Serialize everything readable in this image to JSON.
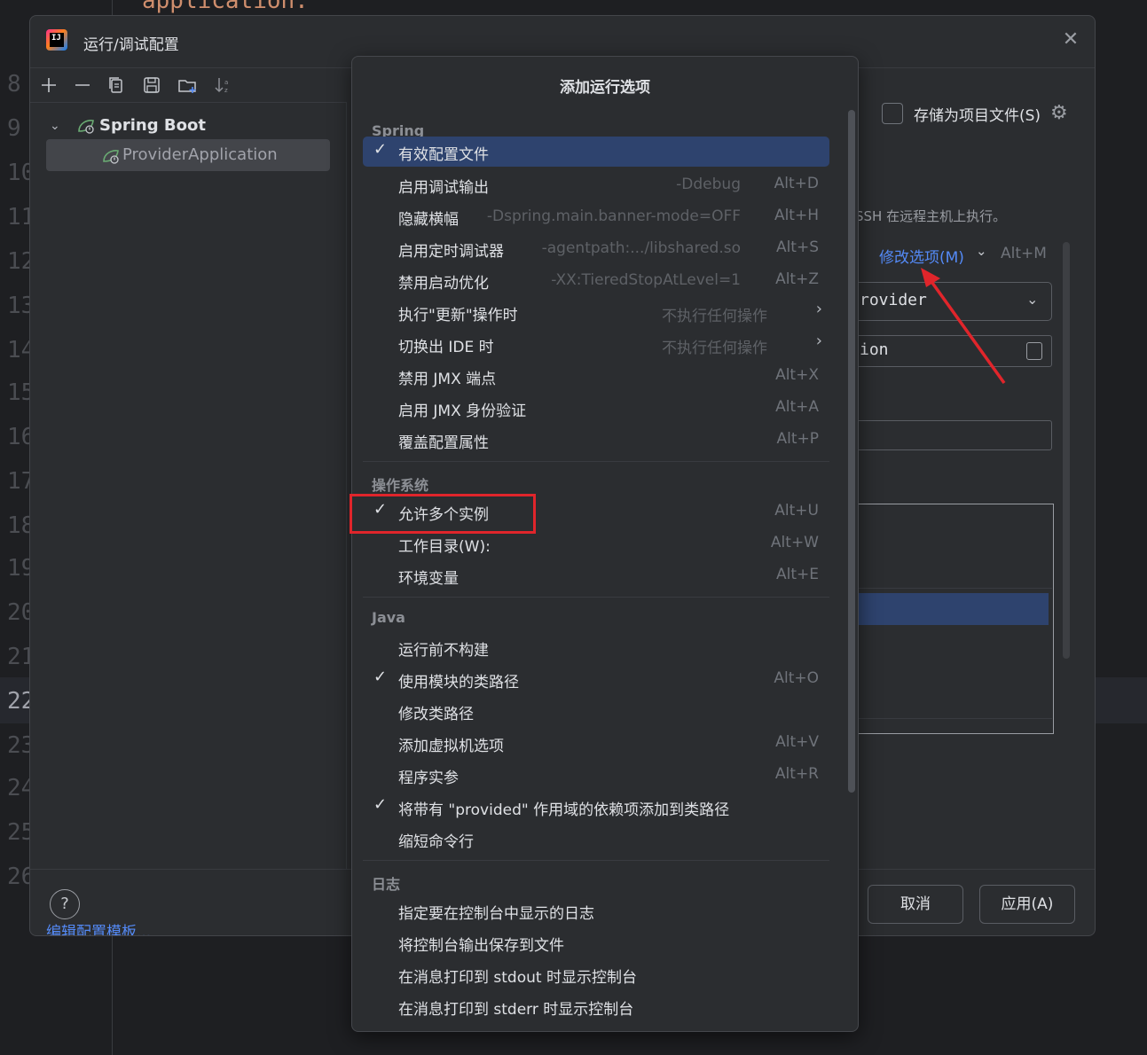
{
  "editor": {
    "code_top": "application:",
    "line_numbers": [
      "8",
      "9",
      "10",
      "11",
      "12",
      "13",
      "14",
      "15",
      "16",
      "17",
      "18",
      "19",
      "20",
      "21",
      "22",
      "23",
      "24",
      "25",
      "26"
    ]
  },
  "dialog": {
    "title": "运行/调试配置",
    "tree": {
      "group": "Spring Boot",
      "item": "ProviderApplication"
    },
    "edit_templates_link": "编辑配置模板...",
    "store_as_project_file": "存储为项目文件(S)",
    "ssh_hint": "SSH 在远程主机上执行。",
    "modify_options": "修改选项(M)",
    "modify_options_shortcut": "Alt+M",
    "field1_value": "rovider",
    "field2_value": "ion",
    "help": "?",
    "cancel_button": "取消",
    "apply_button": "应用(A)"
  },
  "popup": {
    "title": "添加运行选项",
    "sections": [
      {
        "name": "Spring",
        "items": [
          {
            "label": "有效配置文件",
            "checked": true,
            "selected": true,
            "hint": "",
            "shortcut": ""
          },
          {
            "label": "启用调试输出",
            "checked": false,
            "hint": "-Ddebug",
            "shortcut": "Alt+D"
          },
          {
            "label": "隐藏横幅",
            "checked": false,
            "hint": "-Dspring.main.banner-mode=OFF",
            "shortcut": "Alt+H"
          },
          {
            "label": "启用定时调试器",
            "checked": false,
            "hint": "-agentpath:.../libshared.so",
            "shortcut": "Alt+S"
          },
          {
            "label": "禁用启动优化",
            "checked": false,
            "hint": "-XX:TieredStopAtLevel=1",
            "shortcut": "Alt+Z"
          },
          {
            "label": "执行\"更新\"操作时",
            "checked": false,
            "hint": "不执行任何操作",
            "shortcut": "",
            "submenu": true
          },
          {
            "label": "切换出 IDE 时",
            "checked": false,
            "hint": "不执行任何操作",
            "shortcut": "",
            "submenu": true
          },
          {
            "label": "禁用 JMX 端点",
            "checked": false,
            "hint": "",
            "shortcut": "Alt+X"
          },
          {
            "label": "启用 JMX 身份验证",
            "checked": false,
            "hint": "",
            "shortcut": "Alt+A"
          },
          {
            "label": "覆盖配置属性",
            "checked": false,
            "hint": "",
            "shortcut": "Alt+P"
          }
        ]
      },
      {
        "name": "操作系统",
        "items": [
          {
            "label": "允许多个实例",
            "checked": true,
            "hint": "",
            "shortcut": "Alt+U"
          },
          {
            "label": "工作目录(W):",
            "checked": false,
            "hint": "",
            "shortcut": "Alt+W"
          },
          {
            "label": "环境变量",
            "checked": false,
            "hint": "",
            "shortcut": "Alt+E"
          }
        ]
      },
      {
        "name": "Java",
        "items": [
          {
            "label": "运行前不构建",
            "checked": false,
            "hint": "",
            "shortcut": ""
          },
          {
            "label": "使用模块的类路径",
            "checked": true,
            "hint": "",
            "shortcut": "Alt+O"
          },
          {
            "label": "修改类路径",
            "checked": false,
            "hint": "",
            "shortcut": ""
          },
          {
            "label": "添加虚拟机选项",
            "checked": false,
            "hint": "",
            "shortcut": "Alt+V"
          },
          {
            "label": "程序实参",
            "checked": false,
            "hint": "",
            "shortcut": "Alt+R"
          },
          {
            "label": "将带有 \"provided\" 作用域的依赖项添加到类路径",
            "checked": true,
            "hint": "",
            "shortcut": ""
          },
          {
            "label": "缩短命令行",
            "checked": false,
            "hint": "",
            "shortcut": ""
          }
        ]
      },
      {
        "name": "日志",
        "items": [
          {
            "label": "指定要在控制台中显示的日志",
            "checked": false,
            "hint": "",
            "shortcut": ""
          },
          {
            "label": "将控制台输出保存到文件",
            "checked": false,
            "hint": "",
            "shortcut": ""
          },
          {
            "label": "在消息打印到 stdout 时显示控制台",
            "checked": false,
            "hint": "",
            "shortcut": ""
          },
          {
            "label": "在消息打印到 stderr 时显示控制台",
            "checked": false,
            "hint": "",
            "shortcut": ""
          }
        ]
      }
    ]
  },
  "colors": {
    "accent_link": "#548af7",
    "selection": "#2e436e",
    "annotation_red": "#e0252b"
  }
}
